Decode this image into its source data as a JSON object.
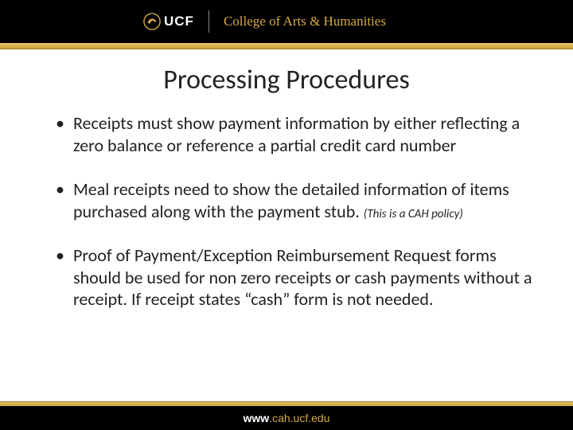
{
  "header": {
    "org_short": "UCF",
    "college": "College of Arts & Humanities"
  },
  "slide": {
    "title": "Processing Procedures",
    "bullets": [
      {
        "text": "Receipts must show payment information by either reflecting a zero balance or reference a partial credit card number",
        "note": ""
      },
      {
        "text": "Meal receipts need to show the detailed information of items purchased along with the payment stub. ",
        "note": "(This is a CAH policy)"
      },
      {
        "text": "Proof of Payment/Exception Reimbursement Request forms should be used for non zero receipts or cash payments without a receipt. If receipt states “cash” form is not needed.",
        "note": ""
      }
    ]
  },
  "footer": {
    "prefix": "www",
    "domain": ".cah.ucf.edu"
  }
}
